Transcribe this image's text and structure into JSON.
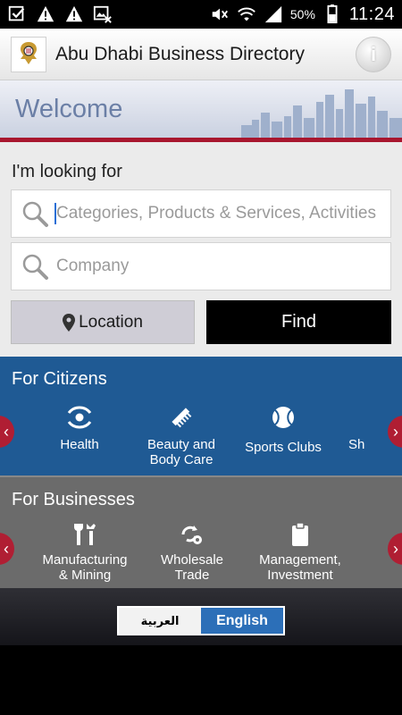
{
  "status_bar": {
    "battery_percent": "50%",
    "time": "11:24",
    "icons": [
      "checkbox-icon",
      "warning-icon",
      "warning-icon",
      "image-blocked-icon",
      "mute-icon",
      "wifi-icon",
      "signal-icon",
      "battery-icon"
    ]
  },
  "header": {
    "title": "Abu Dhabi Business Directory",
    "info_icon": "info-icon"
  },
  "banner": {
    "welcome": "Welcome"
  },
  "search": {
    "heading": "I'm looking for",
    "category_placeholder": "Categories, Products & Services, Activities",
    "company_placeholder": "Company",
    "location_label": "Location",
    "find_label": "Find"
  },
  "citizens": {
    "title": "For Citizens",
    "items": [
      {
        "label": "Health",
        "icon": "health-eye-icon"
      },
      {
        "label": "Beauty and\nBody Care",
        "icon": "comb-icon"
      },
      {
        "label": "Sports Clubs",
        "icon": "tennis-ball-icon"
      },
      {
        "label": "Sh",
        "icon": ""
      }
    ]
  },
  "businesses": {
    "title": "For Businesses",
    "items": [
      {
        "label": "Manufacturing\n& Mining",
        "icon": "tools-icon"
      },
      {
        "label": "Wholesale\nTrade",
        "icon": "recycle-gear-icon"
      },
      {
        "label": "Management,\nInvestment",
        "icon": "clipboard-icon"
      }
    ]
  },
  "language": {
    "arabic": "العربية",
    "english": "English"
  },
  "colors": {
    "citizens_bg": "#1f5a94",
    "businesses_bg": "#6b6b6b",
    "accent_red": "#a8162e",
    "find_bg": "#000000",
    "english_bg": "#2c6fb8"
  }
}
